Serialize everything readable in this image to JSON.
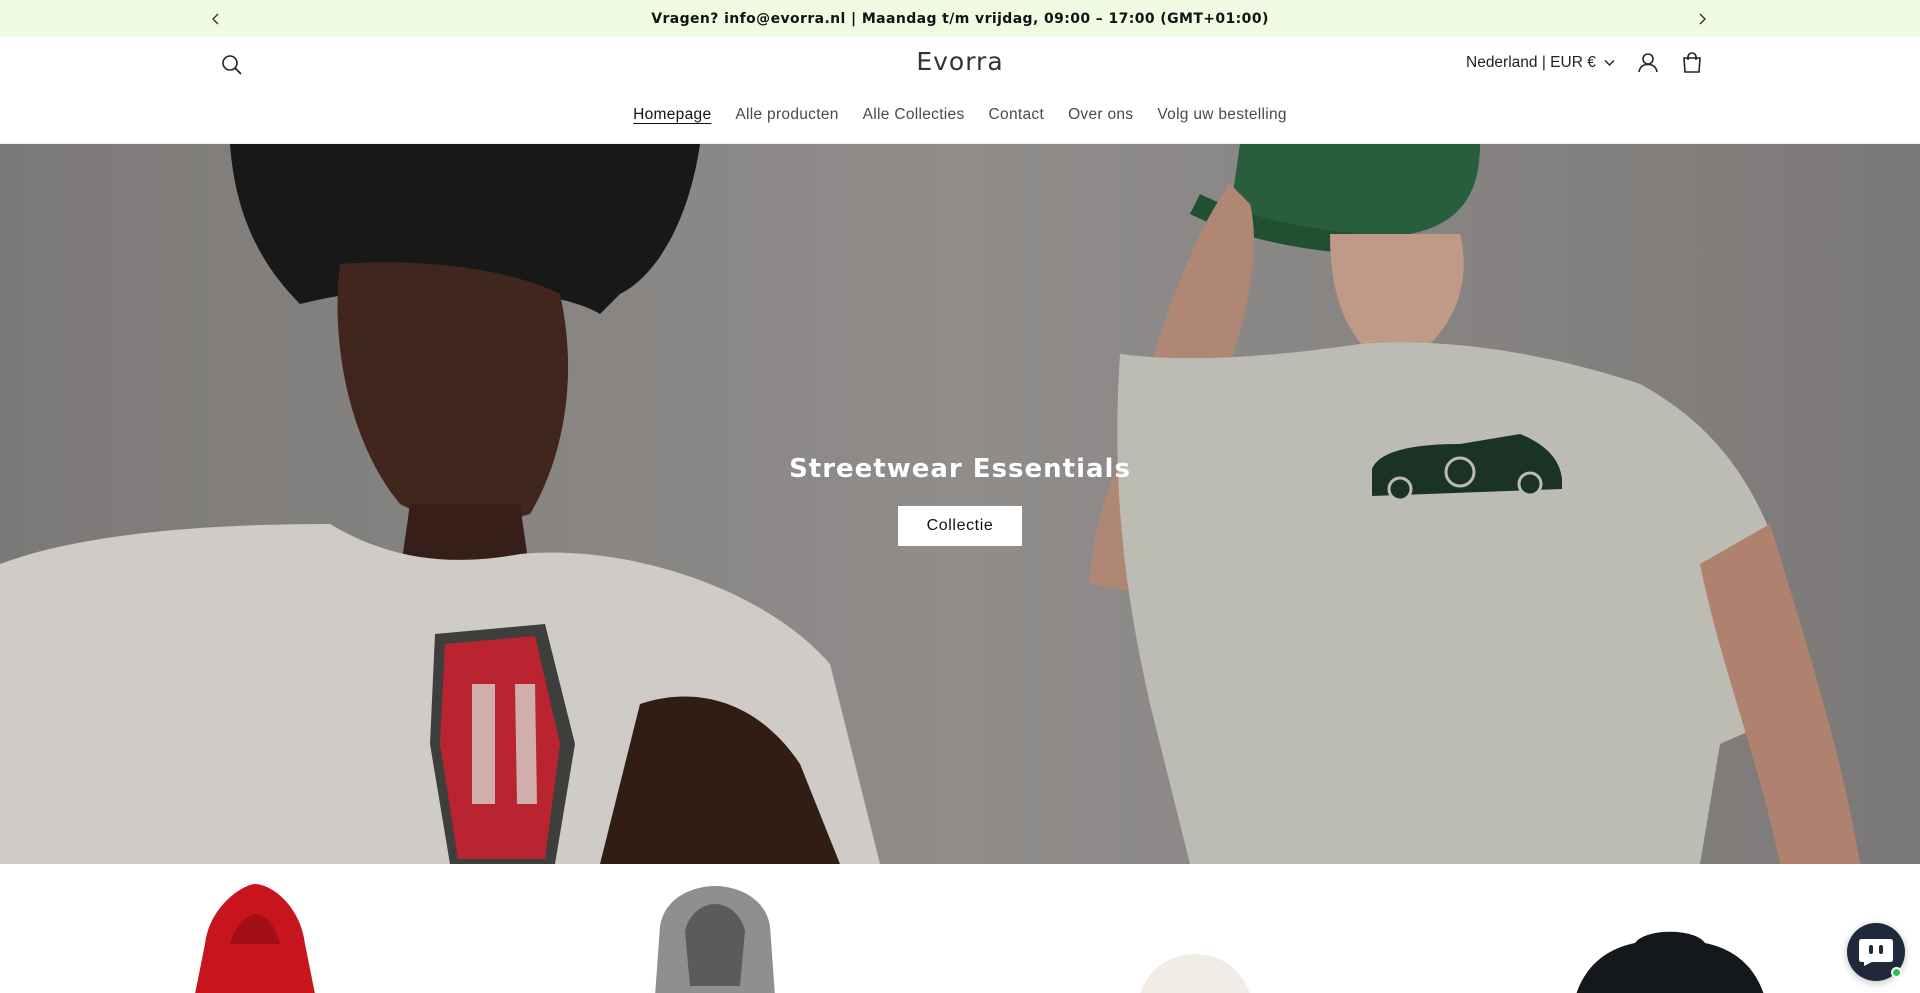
{
  "announcement": {
    "text": "Vragen? info@evorra.nl | Maandag t/m vrijdag, 09:00 – 17:00 (GMT+01:00)",
    "prev_icon": "chevron-left-icon",
    "next_icon": "chevron-right-icon"
  },
  "header": {
    "logo": "Evorra",
    "locale": "Nederland | EUR €",
    "icons": [
      "search-icon",
      "account-icon",
      "cart-icon"
    ]
  },
  "nav": {
    "items": [
      {
        "label": "Homepage",
        "active": true
      },
      {
        "label": "Alle producten"
      },
      {
        "label": "Alle Collecties"
      },
      {
        "label": "Contact"
      },
      {
        "label": "Over ons"
      },
      {
        "label": "Volg uw bestelling"
      }
    ]
  },
  "hero": {
    "title": "Streetwear Essentials",
    "button_label": "Collectie"
  },
  "colors": {
    "announcement_bg": "#f0fbe3",
    "text": "#121212",
    "chat_button": "#1e2a3a",
    "chat_status": "#23c552"
  },
  "chat": {
    "icon": "chat-bot-icon"
  }
}
